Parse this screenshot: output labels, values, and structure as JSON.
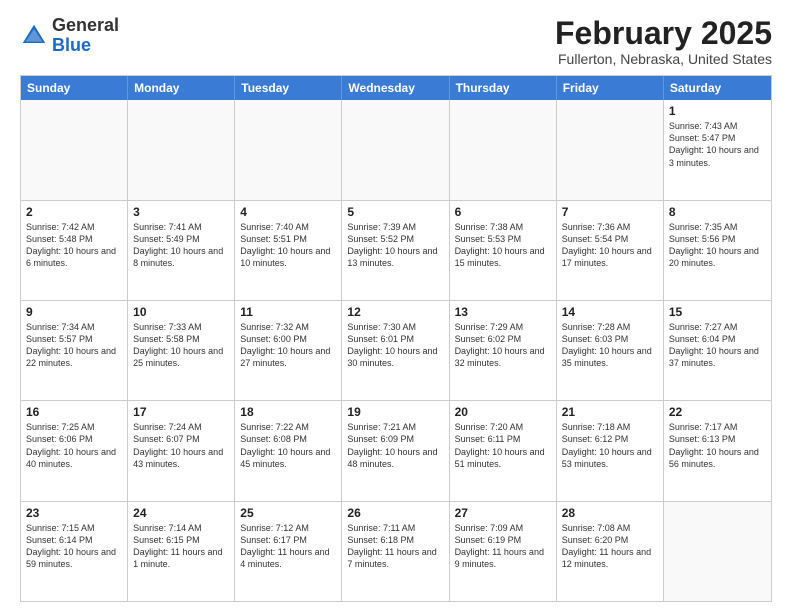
{
  "header": {
    "logo": {
      "general": "General",
      "blue": "Blue"
    },
    "title": "February 2025",
    "location": "Fullerton, Nebraska, United States"
  },
  "days_of_week": [
    "Sunday",
    "Monday",
    "Tuesday",
    "Wednesday",
    "Thursday",
    "Friday",
    "Saturday"
  ],
  "weeks": [
    [
      {
        "day": "",
        "info": ""
      },
      {
        "day": "",
        "info": ""
      },
      {
        "day": "",
        "info": ""
      },
      {
        "day": "",
        "info": ""
      },
      {
        "day": "",
        "info": ""
      },
      {
        "day": "",
        "info": ""
      },
      {
        "day": "1",
        "info": "Sunrise: 7:43 AM\nSunset: 5:47 PM\nDaylight: 10 hours and 3 minutes."
      }
    ],
    [
      {
        "day": "2",
        "info": "Sunrise: 7:42 AM\nSunset: 5:48 PM\nDaylight: 10 hours and 6 minutes."
      },
      {
        "day": "3",
        "info": "Sunrise: 7:41 AM\nSunset: 5:49 PM\nDaylight: 10 hours and 8 minutes."
      },
      {
        "day": "4",
        "info": "Sunrise: 7:40 AM\nSunset: 5:51 PM\nDaylight: 10 hours and 10 minutes."
      },
      {
        "day": "5",
        "info": "Sunrise: 7:39 AM\nSunset: 5:52 PM\nDaylight: 10 hours and 13 minutes."
      },
      {
        "day": "6",
        "info": "Sunrise: 7:38 AM\nSunset: 5:53 PM\nDaylight: 10 hours and 15 minutes."
      },
      {
        "day": "7",
        "info": "Sunrise: 7:36 AM\nSunset: 5:54 PM\nDaylight: 10 hours and 17 minutes."
      },
      {
        "day": "8",
        "info": "Sunrise: 7:35 AM\nSunset: 5:56 PM\nDaylight: 10 hours and 20 minutes."
      }
    ],
    [
      {
        "day": "9",
        "info": "Sunrise: 7:34 AM\nSunset: 5:57 PM\nDaylight: 10 hours and 22 minutes."
      },
      {
        "day": "10",
        "info": "Sunrise: 7:33 AM\nSunset: 5:58 PM\nDaylight: 10 hours and 25 minutes."
      },
      {
        "day": "11",
        "info": "Sunrise: 7:32 AM\nSunset: 6:00 PM\nDaylight: 10 hours and 27 minutes."
      },
      {
        "day": "12",
        "info": "Sunrise: 7:30 AM\nSunset: 6:01 PM\nDaylight: 10 hours and 30 minutes."
      },
      {
        "day": "13",
        "info": "Sunrise: 7:29 AM\nSunset: 6:02 PM\nDaylight: 10 hours and 32 minutes."
      },
      {
        "day": "14",
        "info": "Sunrise: 7:28 AM\nSunset: 6:03 PM\nDaylight: 10 hours and 35 minutes."
      },
      {
        "day": "15",
        "info": "Sunrise: 7:27 AM\nSunset: 6:04 PM\nDaylight: 10 hours and 37 minutes."
      }
    ],
    [
      {
        "day": "16",
        "info": "Sunrise: 7:25 AM\nSunset: 6:06 PM\nDaylight: 10 hours and 40 minutes."
      },
      {
        "day": "17",
        "info": "Sunrise: 7:24 AM\nSunset: 6:07 PM\nDaylight: 10 hours and 43 minutes."
      },
      {
        "day": "18",
        "info": "Sunrise: 7:22 AM\nSunset: 6:08 PM\nDaylight: 10 hours and 45 minutes."
      },
      {
        "day": "19",
        "info": "Sunrise: 7:21 AM\nSunset: 6:09 PM\nDaylight: 10 hours and 48 minutes."
      },
      {
        "day": "20",
        "info": "Sunrise: 7:20 AM\nSunset: 6:11 PM\nDaylight: 10 hours and 51 minutes."
      },
      {
        "day": "21",
        "info": "Sunrise: 7:18 AM\nSunset: 6:12 PM\nDaylight: 10 hours and 53 minutes."
      },
      {
        "day": "22",
        "info": "Sunrise: 7:17 AM\nSunset: 6:13 PM\nDaylight: 10 hours and 56 minutes."
      }
    ],
    [
      {
        "day": "23",
        "info": "Sunrise: 7:15 AM\nSunset: 6:14 PM\nDaylight: 10 hours and 59 minutes."
      },
      {
        "day": "24",
        "info": "Sunrise: 7:14 AM\nSunset: 6:15 PM\nDaylight: 11 hours and 1 minute."
      },
      {
        "day": "25",
        "info": "Sunrise: 7:12 AM\nSunset: 6:17 PM\nDaylight: 11 hours and 4 minutes."
      },
      {
        "day": "26",
        "info": "Sunrise: 7:11 AM\nSunset: 6:18 PM\nDaylight: 11 hours and 7 minutes."
      },
      {
        "day": "27",
        "info": "Sunrise: 7:09 AM\nSunset: 6:19 PM\nDaylight: 11 hours and 9 minutes."
      },
      {
        "day": "28",
        "info": "Sunrise: 7:08 AM\nSunset: 6:20 PM\nDaylight: 11 hours and 12 minutes."
      },
      {
        "day": "",
        "info": ""
      }
    ]
  ]
}
